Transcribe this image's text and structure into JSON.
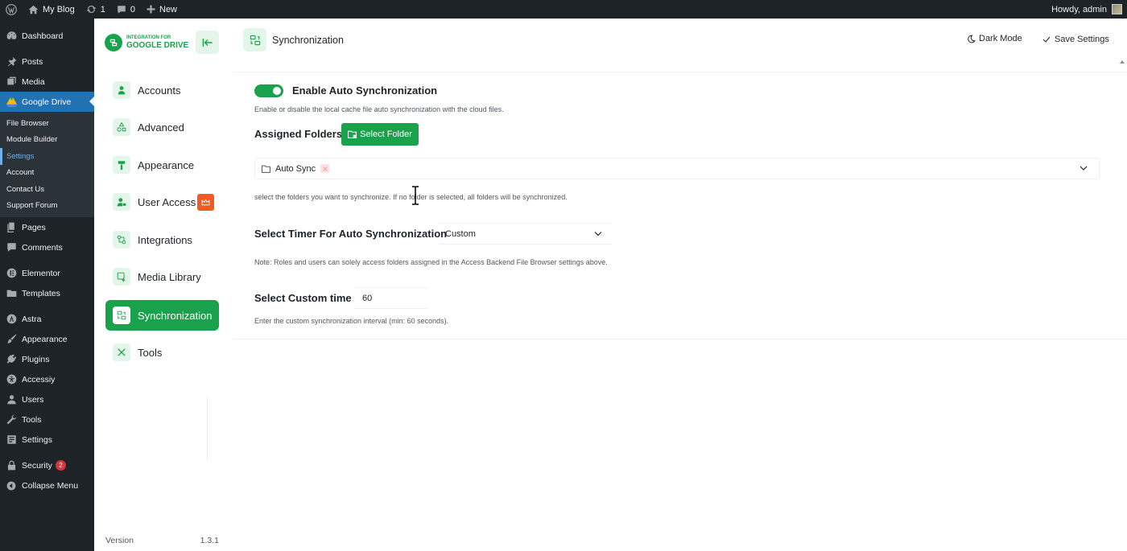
{
  "adminbar": {
    "site_name": "My Blog",
    "updates_count": "1",
    "comments_count": "0",
    "new_label": "New",
    "greeting": "Howdy, admin"
  },
  "adminmenu": {
    "dashboard": "Dashboard",
    "posts": "Posts",
    "media": "Media",
    "google_drive": "Google Drive",
    "sub": {
      "file_browser": "File Browser",
      "module_builder": "Module Builder",
      "settings": "Settings",
      "account": "Account",
      "contact_us": "Contact Us",
      "support_forum": "Support Forum"
    },
    "pages": "Pages",
    "comments": "Comments",
    "elementor": "Elementor",
    "templates": "Templates",
    "astra": "Astra",
    "appearance": "Appearance",
    "plugins": "Plugins",
    "accessiy": "Accessiy",
    "users": "Users",
    "tools": "Tools",
    "settings": "Settings",
    "security": "Security",
    "security_badge": "2",
    "collapse": "Collapse Menu"
  },
  "plugin": {
    "logo_line1": "INTEGRATION FOR",
    "logo_line2": "GOOGLE DRIVE",
    "nav": {
      "accounts": "Accounts",
      "advanced": "Advanced",
      "appearance": "Appearance",
      "user_access": "User Access",
      "integrations": "Integrations",
      "media_library": "Media Library",
      "synchronization": "Synchronization",
      "tools": "Tools"
    },
    "version_label": "Version",
    "version_value": "1.3.1"
  },
  "main": {
    "title": "Synchronization",
    "dark_mode": "Dark Mode",
    "save_settings": "Save Settings",
    "enable_auto_sync_label": "Enable Auto Synchronization",
    "enable_auto_sync_on": true,
    "enable_auto_sync_hint": "Enable or disable the local cache file auto synchronization with the cloud files.",
    "assigned_folders_label": "Assigned Folders",
    "select_folder_btn": "Select Folder",
    "selected_folder": "Auto Sync",
    "folders_hint": "select the folders you want to synchronize. If no folder is selected, all folders will be synchronized.",
    "timer_label": "Select Timer For Auto Synchronization",
    "timer_value": "Custom",
    "timer_note": "Note: Roles and users can solely access folders assigned in the Access Backend File Browser settings above.",
    "custom_time_label": "Select Custom time",
    "custom_time_value": "60",
    "custom_time_hint": "Enter the custom synchronization interval (min: 60 seconds)."
  },
  "colors": {
    "accent_green": "#1aa14b",
    "wp_blue": "#2271b1",
    "admin_dark": "#1d2327",
    "pro_orange": "#f15a24"
  }
}
